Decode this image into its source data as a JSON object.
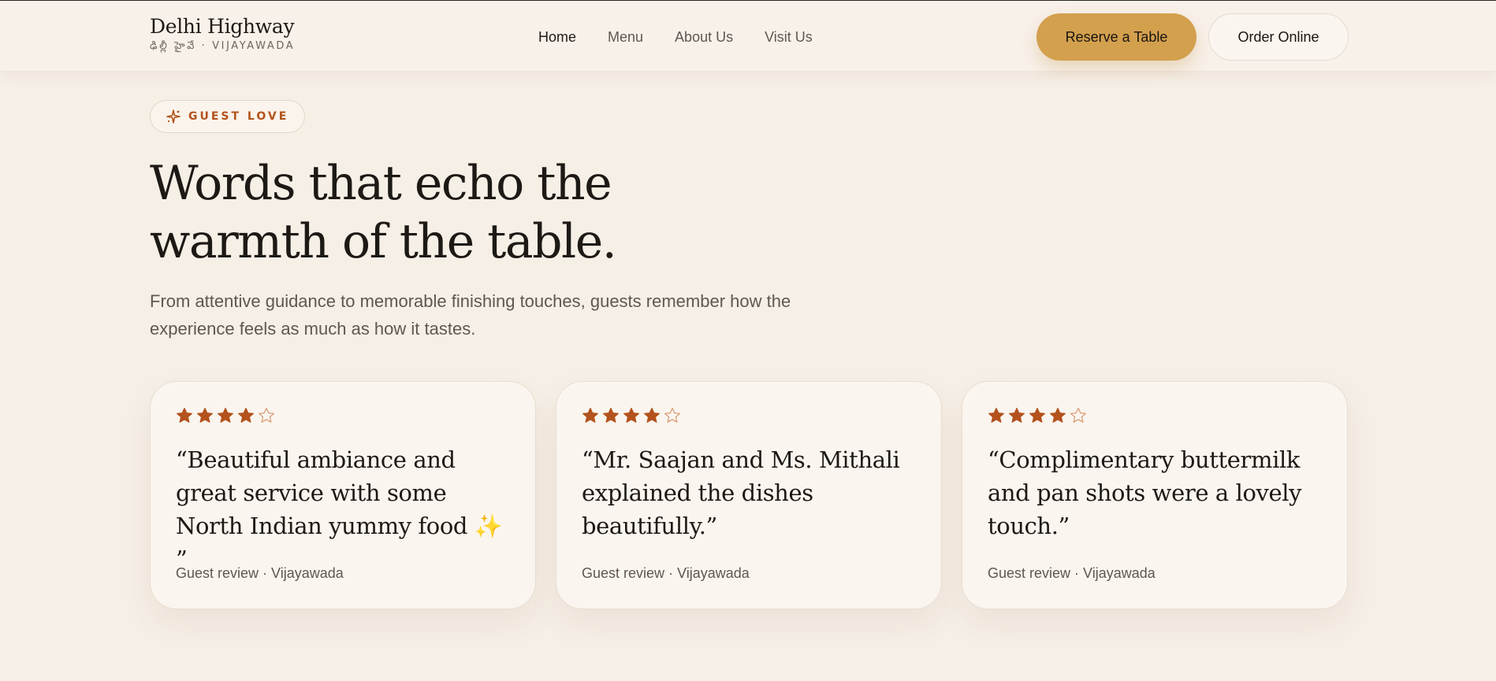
{
  "brand": {
    "name": "Delhi Highway",
    "subtitle": "ఢిల్లీ హైవే · VIJAYAWADA"
  },
  "nav": {
    "items": [
      {
        "label": "Home",
        "active": true
      },
      {
        "label": "Menu",
        "active": false
      },
      {
        "label": "About Us",
        "active": false
      },
      {
        "label": "Visit Us",
        "active": false
      }
    ]
  },
  "header_actions": {
    "reserve_label": "Reserve a Table",
    "order_label": "Order Online"
  },
  "hero": {
    "eyebrow": "GUEST LOVE",
    "eyebrow_icon": "sparkle-icon",
    "headline_line1": "Words that echo the",
    "headline_line2": "warmth of the table.",
    "intro": "From attentive guidance to memorable finishing touches, guests remember how the experience feels as much as how it tastes."
  },
  "reviews": [
    {
      "rating": 4,
      "max_rating": 5,
      "quote": "“Beautiful ambiance and great service with some North Indian yummy food ✨ ”",
      "meta": "Guest review · Vijayawada"
    },
    {
      "rating": 4,
      "max_rating": 5,
      "quote": "“Mr. Saajan and Ms. Mithali explained the dishes beautifully.”",
      "meta": "Guest review · Vijayawada"
    },
    {
      "rating": 4,
      "max_rating": 5,
      "quote": "“Complimentary buttermilk and pan shots were a lovely touch.”",
      "meta": "Guest review · Vijayawada"
    }
  ],
  "colors": {
    "background": "#f6efe6",
    "accent_gold": "#d3a04e",
    "accent_rust": "#b3521c",
    "text_dark": "#1d1915",
    "text_muted": "#5f5750"
  }
}
